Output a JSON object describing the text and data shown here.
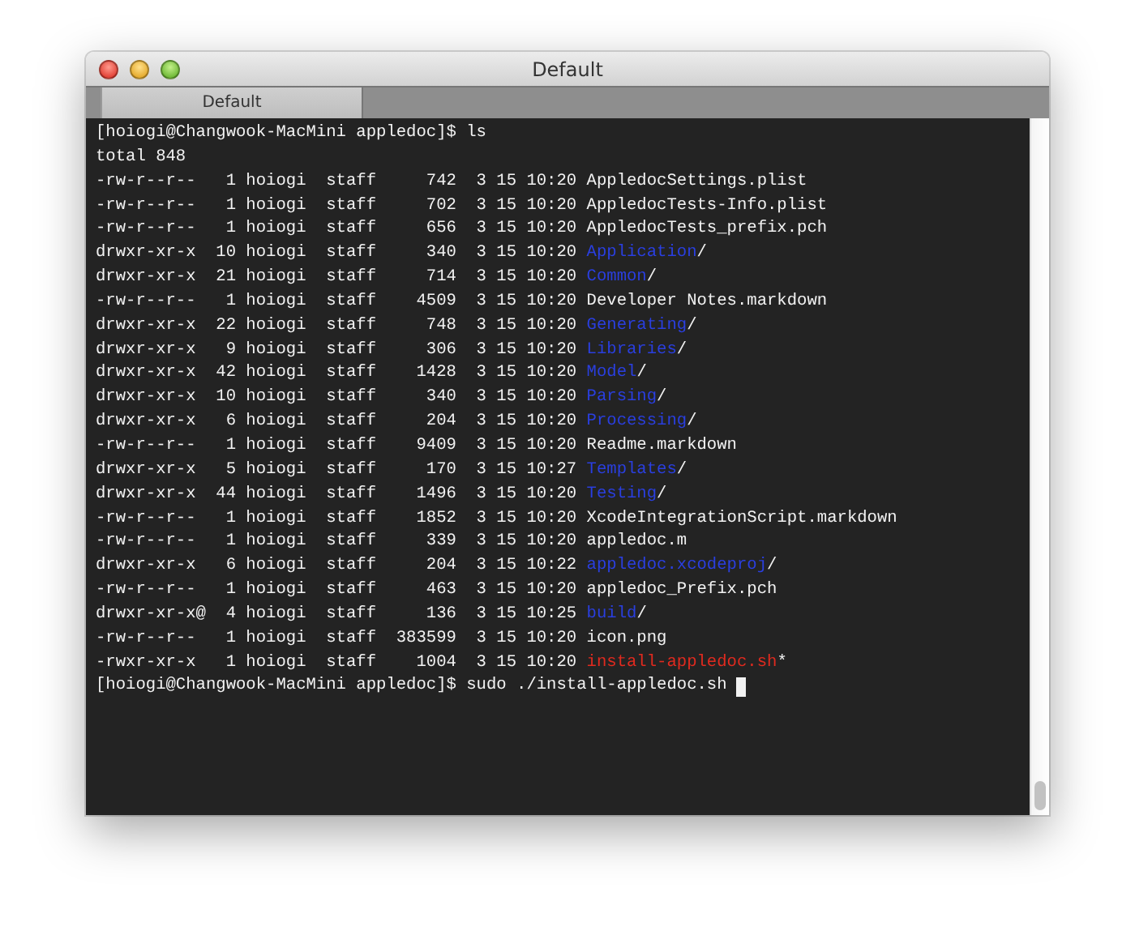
{
  "window": {
    "title": "Default"
  },
  "tabs": [
    {
      "label": "Default",
      "selected": true
    }
  ],
  "terminal": {
    "lines": [
      {
        "kind": "prompt",
        "prompt": "[hoiogi@Changwook-MacMini appledoc]$",
        "command": "ls",
        "cursor": false
      },
      {
        "kind": "text",
        "text": "total 848"
      },
      {
        "kind": "entry",
        "perms": "-rw-r--r--",
        "links": "1",
        "owner": "hoiogi",
        "group": "staff",
        "size": "742",
        "date": "3 15 10:20",
        "name": "AppledocSettings.plist",
        "color": "#f2f2f2"
      },
      {
        "kind": "entry",
        "perms": "-rw-r--r--",
        "links": "1",
        "owner": "hoiogi",
        "group": "staff",
        "size": "702",
        "date": "3 15 10:20",
        "name": "AppledocTests-Info.plist",
        "color": "#f2f2f2"
      },
      {
        "kind": "entry",
        "perms": "-rw-r--r--",
        "links": "1",
        "owner": "hoiogi",
        "group": "staff",
        "size": "656",
        "date": "3 15 10:20",
        "name": "AppledocTests_prefix.pch",
        "color": "#f2f2f2"
      },
      {
        "kind": "entry",
        "perms": "drwxr-xr-x",
        "links": "10",
        "owner": "hoiogi",
        "group": "staff",
        "size": "340",
        "date": "3 15 10:20",
        "name": "Application",
        "suffix": "/",
        "color": "#2a3fe0"
      },
      {
        "kind": "entry",
        "perms": "drwxr-xr-x",
        "links": "21",
        "owner": "hoiogi",
        "group": "staff",
        "size": "714",
        "date": "3 15 10:20",
        "name": "Common",
        "suffix": "/",
        "color": "#2a3fe0"
      },
      {
        "kind": "entry",
        "perms": "-rw-r--r--",
        "links": "1",
        "owner": "hoiogi",
        "group": "staff",
        "size": "4509",
        "date": "3 15 10:20",
        "name": "Developer Notes.markdown",
        "color": "#f2f2f2"
      },
      {
        "kind": "entry",
        "perms": "drwxr-xr-x",
        "links": "22",
        "owner": "hoiogi",
        "group": "staff",
        "size": "748",
        "date": "3 15 10:20",
        "name": "Generating",
        "suffix": "/",
        "color": "#2a3fe0"
      },
      {
        "kind": "entry",
        "perms": "drwxr-xr-x",
        "links": "9",
        "owner": "hoiogi",
        "group": "staff",
        "size": "306",
        "date": "3 15 10:20",
        "name": "Libraries",
        "suffix": "/",
        "color": "#2a3fe0"
      },
      {
        "kind": "entry",
        "perms": "drwxr-xr-x",
        "links": "42",
        "owner": "hoiogi",
        "group": "staff",
        "size": "1428",
        "date": "3 15 10:20",
        "name": "Model",
        "suffix": "/",
        "color": "#2a3fe0"
      },
      {
        "kind": "entry",
        "perms": "drwxr-xr-x",
        "links": "10",
        "owner": "hoiogi",
        "group": "staff",
        "size": "340",
        "date": "3 15 10:20",
        "name": "Parsing",
        "suffix": "/",
        "color": "#2a3fe0"
      },
      {
        "kind": "entry",
        "perms": "drwxr-xr-x",
        "links": "6",
        "owner": "hoiogi",
        "group": "staff",
        "size": "204",
        "date": "3 15 10:20",
        "name": "Processing",
        "suffix": "/",
        "color": "#2a3fe0"
      },
      {
        "kind": "entry",
        "perms": "-rw-r--r--",
        "links": "1",
        "owner": "hoiogi",
        "group": "staff",
        "size": "9409",
        "date": "3 15 10:20",
        "name": "Readme.markdown",
        "color": "#f2f2f2"
      },
      {
        "kind": "entry",
        "perms": "drwxr-xr-x",
        "links": "5",
        "owner": "hoiogi",
        "group": "staff",
        "size": "170",
        "date": "3 15 10:27",
        "name": "Templates",
        "suffix": "/",
        "color": "#2a3fe0"
      },
      {
        "kind": "entry",
        "perms": "drwxr-xr-x",
        "links": "44",
        "owner": "hoiogi",
        "group": "staff",
        "size": "1496",
        "date": "3 15 10:20",
        "name": "Testing",
        "suffix": "/",
        "color": "#2a3fe0"
      },
      {
        "kind": "entry",
        "perms": "-rw-r--r--",
        "links": "1",
        "owner": "hoiogi",
        "group": "staff",
        "size": "1852",
        "date": "3 15 10:20",
        "name": "XcodeIntegrationScript.markdown",
        "color": "#f2f2f2"
      },
      {
        "kind": "entry",
        "perms": "-rw-r--r--",
        "links": "1",
        "owner": "hoiogi",
        "group": "staff",
        "size": "339",
        "date": "3 15 10:20",
        "name": "appledoc.m",
        "color": "#f2f2f2"
      },
      {
        "kind": "entry",
        "perms": "drwxr-xr-x",
        "links": "6",
        "owner": "hoiogi",
        "group": "staff",
        "size": "204",
        "date": "3 15 10:22",
        "name": "appledoc.xcodeproj",
        "suffix": "/",
        "color": "#2a3fe0"
      },
      {
        "kind": "entry",
        "perms": "-rw-r--r--",
        "links": "1",
        "owner": "hoiogi",
        "group": "staff",
        "size": "463",
        "date": "3 15 10:20",
        "name": "appledoc_Prefix.pch",
        "color": "#f2f2f2"
      },
      {
        "kind": "entry",
        "perms": "drwxr-xr-x@",
        "links": "4",
        "owner": "hoiogi",
        "group": "staff",
        "size": "136",
        "date": "3 15 10:25",
        "name": "build",
        "suffix": "/",
        "color": "#2a3fe0"
      },
      {
        "kind": "entry",
        "perms": "-rw-r--r--",
        "links": "1",
        "owner": "hoiogi",
        "group": "staff",
        "size": "383599",
        "date": "3 15 10:20",
        "name": "icon.png",
        "color": "#f2f2f2"
      },
      {
        "kind": "entry",
        "perms": "-rwxr-xr-x",
        "links": "1",
        "owner": "hoiogi",
        "group": "staff",
        "size": "1004",
        "date": "3 15 10:20",
        "name": "install-appledoc.sh",
        "suffix": "*",
        "color": "#e02a1f"
      },
      {
        "kind": "prompt",
        "prompt": "[hoiogi@Changwook-MacMini appledoc]$",
        "command": "sudo ./install-appledoc.sh",
        "cursor": true
      }
    ]
  }
}
